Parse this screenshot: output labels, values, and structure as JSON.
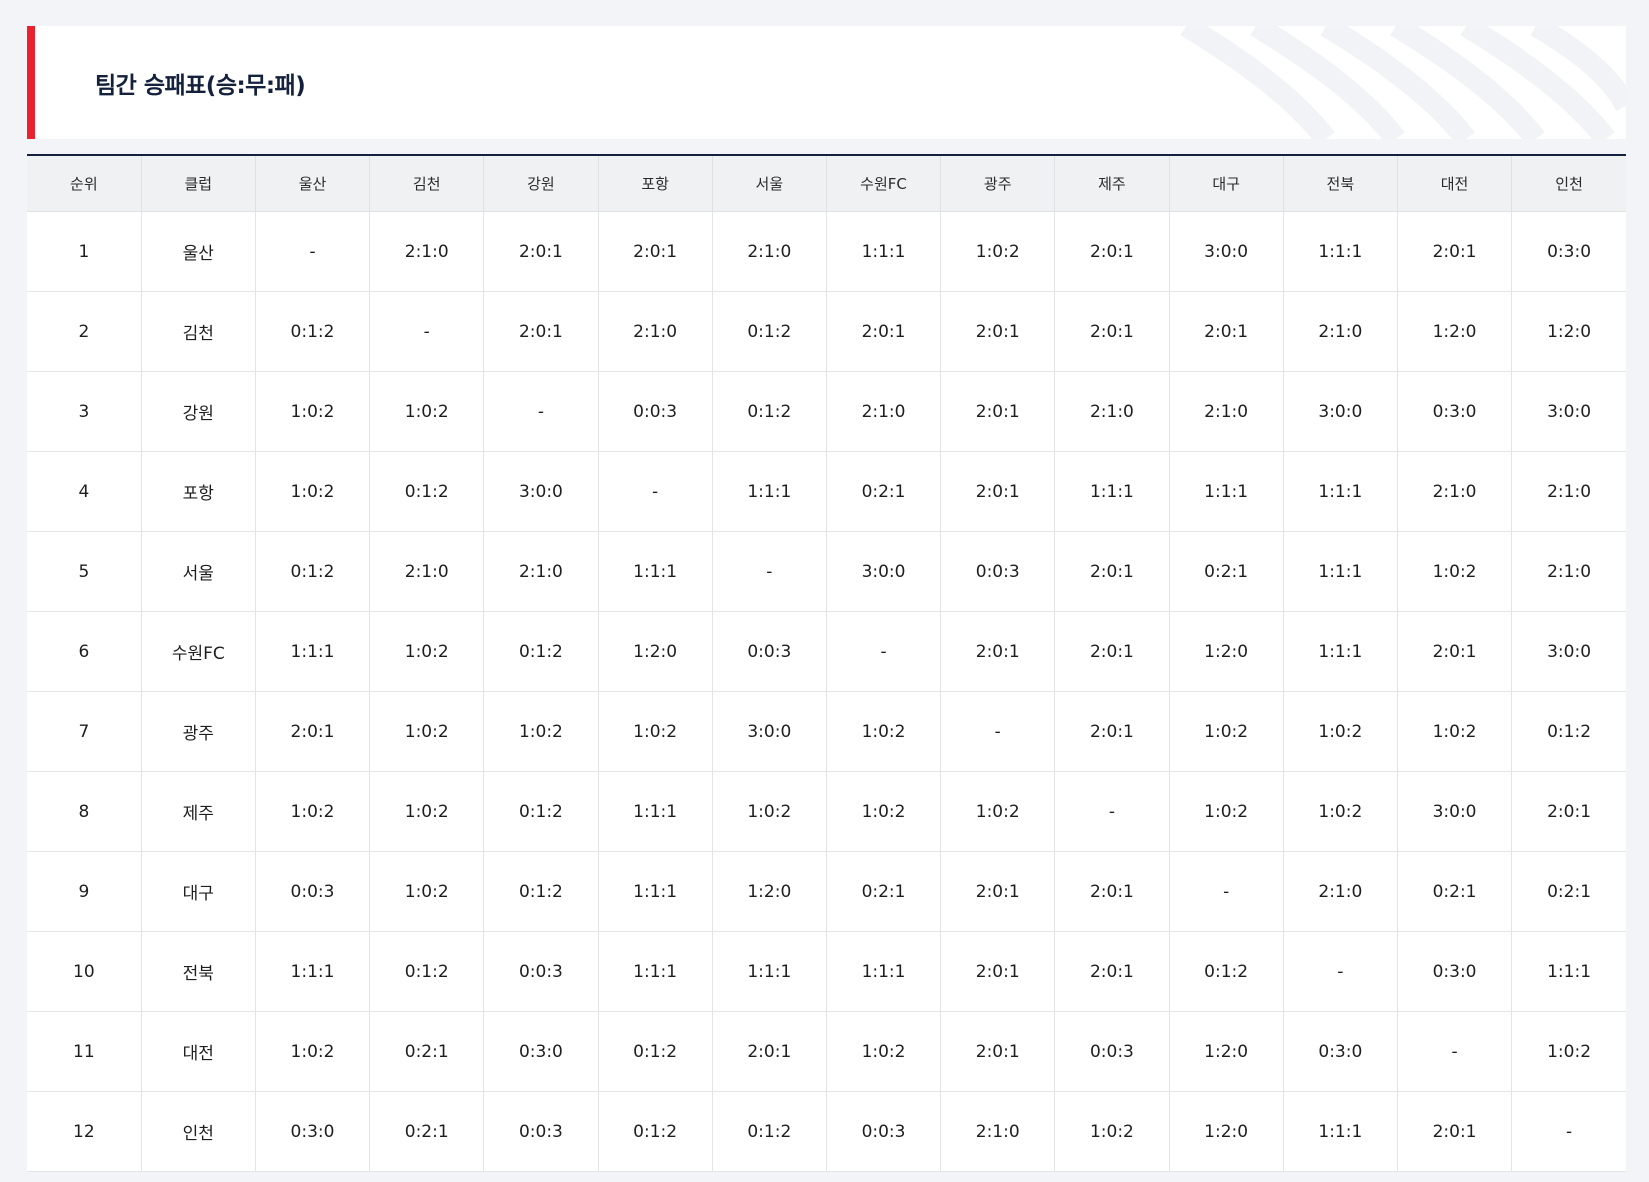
{
  "page": {
    "title": "팀간 승패표(승:무:패)"
  },
  "table": {
    "headers": [
      "순위",
      "클럽",
      "울산",
      "김천",
      "강원",
      "포항",
      "서울",
      "수원FC",
      "광주",
      "제주",
      "대구",
      "전북",
      "대전",
      "인천"
    ],
    "rows": [
      {
        "rank": "1",
        "club": "울산",
        "cells": [
          "-",
          "2:1:0",
          "2:0:1",
          "2:0:1",
          "2:1:0",
          "1:1:1",
          "1:0:2",
          "2:0:1",
          "3:0:0",
          "1:1:1",
          "2:0:1",
          "0:3:0"
        ]
      },
      {
        "rank": "2",
        "club": "김천",
        "cells": [
          "0:1:2",
          "-",
          "2:0:1",
          "2:1:0",
          "0:1:2",
          "2:0:1",
          "2:0:1",
          "2:0:1",
          "2:0:1",
          "2:1:0",
          "1:2:0",
          "1:2:0"
        ]
      },
      {
        "rank": "3",
        "club": "강원",
        "cells": [
          "1:0:2",
          "1:0:2",
          "-",
          "0:0:3",
          "0:1:2",
          "2:1:0",
          "2:0:1",
          "2:1:0",
          "2:1:0",
          "3:0:0",
          "0:3:0",
          "3:0:0"
        ]
      },
      {
        "rank": "4",
        "club": "포항",
        "cells": [
          "1:0:2",
          "0:1:2",
          "3:0:0",
          "-",
          "1:1:1",
          "0:2:1",
          "2:0:1",
          "1:1:1",
          "1:1:1",
          "1:1:1",
          "2:1:0",
          "2:1:0"
        ]
      },
      {
        "rank": "5",
        "club": "서울",
        "cells": [
          "0:1:2",
          "2:1:0",
          "2:1:0",
          "1:1:1",
          "-",
          "3:0:0",
          "0:0:3",
          "2:0:1",
          "0:2:1",
          "1:1:1",
          "1:0:2",
          "2:1:0"
        ]
      },
      {
        "rank": "6",
        "club": "수원FC",
        "cells": [
          "1:1:1",
          "1:0:2",
          "0:1:2",
          "1:2:0",
          "0:0:3",
          "-",
          "2:0:1",
          "2:0:1",
          "1:2:0",
          "1:1:1",
          "2:0:1",
          "3:0:0"
        ]
      },
      {
        "rank": "7",
        "club": "광주",
        "cells": [
          "2:0:1",
          "1:0:2",
          "1:0:2",
          "1:0:2",
          "3:0:0",
          "1:0:2",
          "-",
          "2:0:1",
          "1:0:2",
          "1:0:2",
          "1:0:2",
          "0:1:2"
        ]
      },
      {
        "rank": "8",
        "club": "제주",
        "cells": [
          "1:0:2",
          "1:0:2",
          "0:1:2",
          "1:1:1",
          "1:0:2",
          "1:0:2",
          "1:0:2",
          "-",
          "1:0:2",
          "1:0:2",
          "3:0:0",
          "2:0:1"
        ]
      },
      {
        "rank": "9",
        "club": "대구",
        "cells": [
          "0:0:3",
          "1:0:2",
          "0:1:2",
          "1:1:1",
          "1:2:0",
          "0:2:1",
          "2:0:1",
          "2:0:1",
          "-",
          "2:1:0",
          "0:2:1",
          "0:2:1"
        ]
      },
      {
        "rank": "10",
        "club": "전북",
        "cells": [
          "1:1:1",
          "0:1:2",
          "0:0:3",
          "1:1:1",
          "1:1:1",
          "1:1:1",
          "2:0:1",
          "2:0:1",
          "0:1:2",
          "-",
          "0:3:0",
          "1:1:1"
        ]
      },
      {
        "rank": "11",
        "club": "대전",
        "cells": [
          "1:0:2",
          "0:2:1",
          "0:3:0",
          "0:1:2",
          "2:0:1",
          "1:0:2",
          "2:0:1",
          "0:0:3",
          "1:2:0",
          "0:3:0",
          "-",
          "1:0:2"
        ]
      },
      {
        "rank": "12",
        "club": "인천",
        "cells": [
          "0:3:0",
          "0:2:1",
          "0:0:3",
          "0:1:2",
          "0:1:2",
          "0:0:3",
          "2:1:0",
          "1:0:2",
          "1:2:0",
          "1:1:1",
          "2:0:1",
          "-"
        ]
      }
    ]
  },
  "colors": {
    "accent": "#e8232f",
    "title": "#14213d",
    "header_bg": "#f0f1f3"
  }
}
